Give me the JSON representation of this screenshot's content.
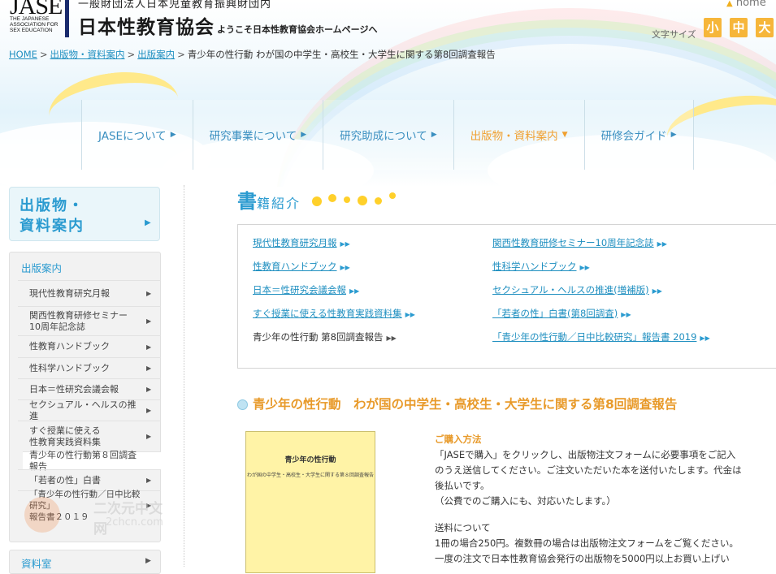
{
  "header": {
    "logo_mark": "JASE",
    "logo_sub": [
      "THE JAPANESE",
      "ASSOCIATION FOR",
      "SEX EDUCATION"
    ],
    "org_top": "一般財団法人日本児童教育振興財団内",
    "org_name": "日本性教育協会",
    "welcome": "ようこそ日本性教育協会ホームページへ",
    "home": "home",
    "font_size_label": "文字サイズ",
    "font_sizes": [
      "小",
      "中",
      "大"
    ]
  },
  "breadcrumb": {
    "home": "HOME",
    "level1": "出版物・資料案内",
    "level2": "出版案内",
    "current": "青少年の性行動 わが国の中学生・高校生・大学生に関する第8回調査報告"
  },
  "nav": [
    {
      "label": "JASEについて"
    },
    {
      "label": "研究事業について"
    },
    {
      "label": "研究助成について"
    },
    {
      "label": "出版物・資料案内"
    },
    {
      "label": "研修会ガイド"
    }
  ],
  "sidebar": {
    "title_line1": "出版物・",
    "title_line2": "資料案内",
    "section_head": "出版案内",
    "items": [
      {
        "label": "現代性教育研究月報"
      },
      {
        "label": "関西性教育研修セミナー\n10周年記念誌"
      },
      {
        "label": "性教育ハンドブック"
      },
      {
        "label": "性科学ハンドブック"
      },
      {
        "label": "日本＝性研究会議会報"
      },
      {
        "label": "セクシュアル・ヘルスの推進"
      },
      {
        "label": "すぐ授業に使える\n性教育実践資料集"
      },
      {
        "label": "青少年の性行動第８回調査報告"
      },
      {
        "label": "「若者の性」白書"
      },
      {
        "label": "「青少年の性行動／日中比較研究」\n報告書２０１９"
      }
    ],
    "bottom": "資料室"
  },
  "watermark": {
    "cn": "二次元中文网",
    "en": "2chcn.com"
  },
  "books": {
    "title_big": "書",
    "title_rest": "籍紹介",
    "left": [
      "現代性教育研究月報",
      "性教育ハンドブック",
      "日本＝性研究会議会報",
      "すぐ授業に使える性教育実践資料集",
      "青少年の性行動 第8回調査報告"
    ],
    "right": [
      "関西性教育研修セミナー10周年記念誌",
      "性科学ハンドブック",
      "セクシュアル・ヘルスの推進(増補版)",
      "「若者の性」白書(第8回調査)",
      "「青少年の性行動／日中比較研究」報告書 2019"
    ]
  },
  "article": {
    "title": "青少年の性行動　わが国の中学生・高校生・大学生に関する第8回調査報告",
    "cover_title": "青少年の性行動",
    "cover_sub": "わが国の中学生・高校生・大学生に関する第８回調査報告",
    "purchase_head": "ご購入方法",
    "purchase_p1": "「JASEで購入」をクリックし、出版物注文フォームに必要事項をご記入のうえ送信してください。ご注文いただいた本を送付いたします。代金は後払いです。",
    "purchase_p2": "（公費でのご購入にも、対応いたします。）",
    "shipping_head": "送料について",
    "shipping_p1": "1冊の場合250円。複数冊の場合は出版物注文フォームをご覧ください。",
    "shipping_p2": "一度の注文で日本性教育協会発行の出版物を5000円以上お買い上げい"
  }
}
